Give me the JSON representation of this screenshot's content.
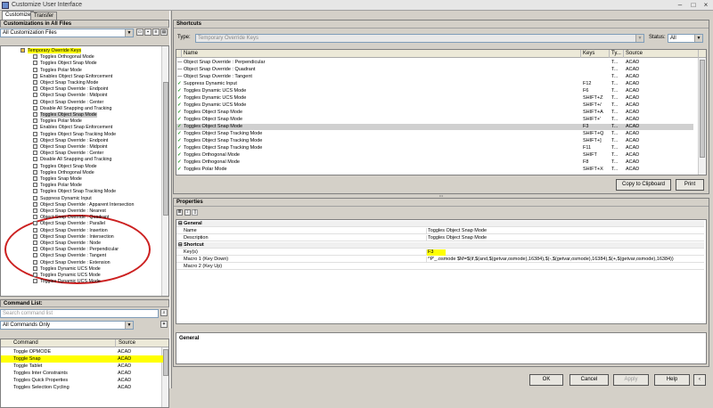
{
  "window": {
    "title": "Customize User Interface"
  },
  "tabs": [
    "Customize",
    "Transfer"
  ],
  "left": {
    "header": "Customizations in All Files",
    "combo": "All Customization Files",
    "tree": [
      {
        "label": "Temporary Override Keys",
        "hl": true,
        "indent": 28,
        "icon": false
      },
      {
        "label": "Toggles Orthogonal Mode"
      },
      {
        "label": "Toggles Object Snap Mode"
      },
      {
        "label": "Toggles Polar Mode"
      },
      {
        "label": "Enables Object Snap Enforcement"
      },
      {
        "label": "Object Snap Tracking Mode"
      },
      {
        "label": "Object Snap Override : Endpoint"
      },
      {
        "label": "Object Snap Override : Midpoint"
      },
      {
        "label": "Object Snap Override : Center"
      },
      {
        "label": "Disable All Snapping and Tracking"
      },
      {
        "label": "Toggles Object Snap Mode",
        "sel": true
      },
      {
        "label": "Toggles Polar Mode"
      },
      {
        "label": "Enables Object Snap Enforcement"
      },
      {
        "label": "Toggles Object Snap Tracking Mode"
      },
      {
        "label": "Object Snap Override : Endpoint"
      },
      {
        "label": "Object Snap Override : Midpoint"
      },
      {
        "label": "Object Snap Override : Center"
      },
      {
        "label": "Disable All Snapping and Tracking"
      },
      {
        "label": "Toggles Object Snap Mode"
      },
      {
        "label": "Toggles Orthogonal Mode"
      },
      {
        "label": "Toggles Snap Mode"
      },
      {
        "label": "Toggles Polar Mode"
      },
      {
        "label": "Toggles Object Snap Tracking Mode"
      },
      {
        "label": "Suppress Dynamic Input"
      },
      {
        "label": "Object Snap Override : Apparent Intersection"
      },
      {
        "label": "Object Snap Override : Nearest"
      },
      {
        "label": "Object Snap Override : Quadrant"
      },
      {
        "label": "Object Snap Override : Parallel"
      },
      {
        "label": "Object Snap Override : Insertion"
      },
      {
        "label": "Object Snap Override : Intersection"
      },
      {
        "label": "Object Snap Override : Node"
      },
      {
        "label": "Object Snap Override : Perpendicular"
      },
      {
        "label": "Object Snap Override : Tangent"
      },
      {
        "label": "Object Snap Override : Extension"
      },
      {
        "label": "Toggles Dynamic UCS Mode"
      },
      {
        "label": "Toggles Dynamic UCS Mode"
      },
      {
        "label": "Toggles Dynamic UCS Mode"
      }
    ]
  },
  "commands": {
    "header": "Command List:",
    "search_placeholder": "Search command list",
    "filter": "All Commands Only",
    "col_command": "Command",
    "col_source": "Source",
    "rows": [
      {
        "cmd": "Toggle OPMODE",
        "src": "ACAD"
      },
      {
        "cmd": "Toggle Snap",
        "src": "ACAD",
        "hl": true
      },
      {
        "cmd": "Toggle Tablet",
        "src": "ACAD"
      },
      {
        "cmd": "Toggles Inter Constraints",
        "src": "ACAD"
      },
      {
        "cmd": "Toggles Quick Properties",
        "src": "ACAD"
      },
      {
        "cmd": "Toggles Selection Cycling",
        "src": "ACAD"
      }
    ]
  },
  "shortcuts": {
    "header": "Shortcuts",
    "type_label": "Type:",
    "type_value": "Temporary Override Keys",
    "status_label": "Status:",
    "status_value": "All",
    "cols": [
      "Name",
      "Keys",
      "Ty...",
      "Source"
    ],
    "rows": [
      {
        "name": "Object Snap Override : Perpendicular",
        "keys": "",
        "ty": "T...",
        "src": "ACAD",
        "mark": "dash"
      },
      {
        "name": "Object Snap Override : Quadrant",
        "keys": "",
        "ty": "T...",
        "src": "ACAD",
        "mark": "dash"
      },
      {
        "name": "Object Snap Override : Tangent",
        "keys": "",
        "ty": "T...",
        "src": "ACAD",
        "mark": "dash"
      },
      {
        "name": "Suppress Dynamic Input",
        "keys": "F12",
        "ty": "T...",
        "src": "ACAD",
        "mark": "check"
      },
      {
        "name": "Toggles Dynamic UCS Mode",
        "keys": "F6",
        "ty": "T...",
        "src": "ACAD",
        "mark": "check"
      },
      {
        "name": "Toggles Dynamic UCS Mode",
        "keys": "SHIFT+Z",
        "ty": "T...",
        "src": "ACAD",
        "mark": "check"
      },
      {
        "name": "Toggles Dynamic UCS Mode",
        "keys": "SHIFT+/",
        "ty": "T...",
        "src": "ACAD",
        "mark": "check"
      },
      {
        "name": "Toggles Object Snap Mode",
        "keys": "SHIFT+A",
        "ty": "T...",
        "src": "ACAD",
        "mark": "check"
      },
      {
        "name": "Toggles Object Snap Mode",
        "keys": "SHIFT+'",
        "ty": "T...",
        "src": "ACAD",
        "mark": "check"
      },
      {
        "name": "Toggles Object Snap Mode",
        "keys": "F3",
        "ty": "T...",
        "src": "ACAD",
        "mark": "check",
        "sel": true
      },
      {
        "name": "Toggles Object Snap Tracking Mode",
        "keys": "SHIFT+Q",
        "ty": "T...",
        "src": "ACAD",
        "mark": "check"
      },
      {
        "name": "Toggles Object Snap Tracking Mode",
        "keys": "SHIFT+]",
        "ty": "T...",
        "src": "ACAD",
        "mark": "check"
      },
      {
        "name": "Toggles Object Snap Tracking Mode",
        "keys": "F11",
        "ty": "T...",
        "src": "ACAD",
        "mark": "check"
      },
      {
        "name": "Toggles Orthogonal Mode",
        "keys": "SHIFT",
        "ty": "T...",
        "src": "ACAD",
        "mark": "check"
      },
      {
        "name": "Toggles Orthogonal Mode",
        "keys": "F8",
        "ty": "T...",
        "src": "ACAD",
        "mark": "check"
      },
      {
        "name": "Toggles Polar Mode",
        "keys": "SHIFT+X",
        "ty": "T...",
        "src": "ACAD",
        "mark": "check"
      }
    ],
    "copy_button": "Copy to Clipboard",
    "print_button": "Print"
  },
  "properties": {
    "header": "Properties",
    "rows": [
      {
        "cat": true,
        "name": "General"
      },
      {
        "name": "Name",
        "value": "Toggles Object Snap Mode"
      },
      {
        "name": "Description",
        "value": "Toggles Object Snap Mode"
      },
      {
        "cat": true,
        "name": "Shortcut"
      },
      {
        "name": "Key(s)",
        "value": "F3",
        "hl": true
      },
      {
        "name": "Macro 1 (Key Down)",
        "value": "^P'_.osmode $M=$(if,$(and,$(getvar,osmode),16384),$(-,$(getvar,osmode),16384),$(+,$(getvar,osmode),16384))"
      },
      {
        "name": "Macro 2 (Key Up)",
        "value": ""
      }
    ],
    "description_title": "General"
  },
  "footer": {
    "ok": "OK",
    "cancel": "Cancel",
    "apply": "Apply",
    "help": "Help"
  }
}
